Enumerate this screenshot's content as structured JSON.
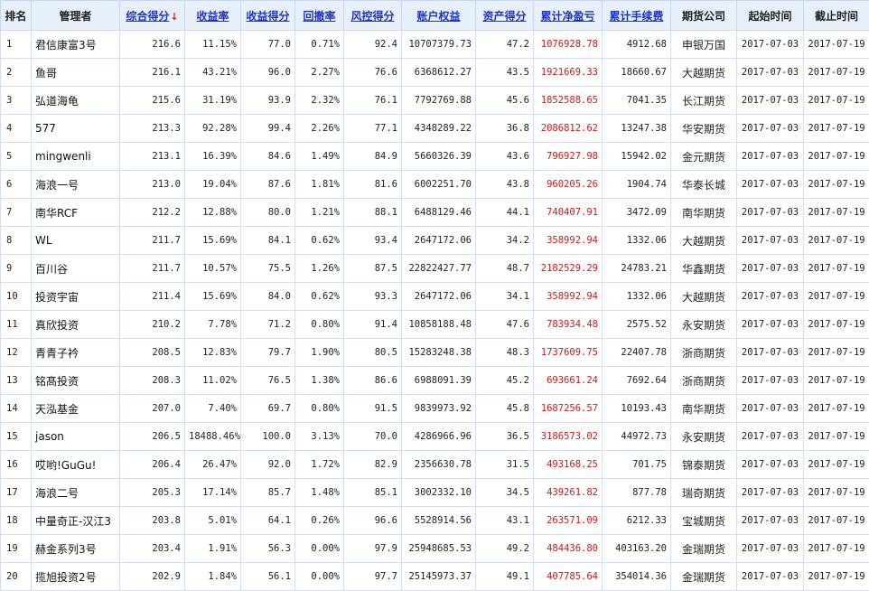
{
  "headers": {
    "rank": "排名",
    "manager": "管理者",
    "total_score": "综合得分",
    "sort_arrow": "↓",
    "yield": "收益率",
    "yield_score": "收益得分",
    "drawdown": "回撤率",
    "risk_score": "风控得分",
    "equity": "账户权益",
    "asset_score": "资产得分",
    "net_pnl": "累计净盈亏",
    "fees": "累计手续费",
    "broker": "期货公司",
    "start": "起始时间",
    "end": "截止时间"
  },
  "colors": {
    "header_bg": "#e8f0fb",
    "link": "#1a35c9",
    "pnl_red": "#d01818",
    "sort_arrow": "#e02020"
  },
  "rows": [
    {
      "rank": "1",
      "manager": "君信康富3号",
      "total_score": "216.6",
      "yield": "11.15%",
      "yield_score": "77.0",
      "drawdown": "0.71%",
      "risk_score": "92.4",
      "equity": "10707379.73",
      "asset_score": "47.2",
      "net_pnl": "1076928.78",
      "fees": "4912.68",
      "broker": "申银万国",
      "start": "2017-07-03",
      "end": "2017-07-19"
    },
    {
      "rank": "2",
      "manager": "鱼哥",
      "total_score": "216.1",
      "yield": "43.21%",
      "yield_score": "96.0",
      "drawdown": "2.27%",
      "risk_score": "76.6",
      "equity": "6368612.27",
      "asset_score": "43.5",
      "net_pnl": "1921669.33",
      "fees": "18660.67",
      "broker": "大越期货",
      "start": "2017-07-03",
      "end": "2017-07-19"
    },
    {
      "rank": "3",
      "manager": "弘道海龟",
      "total_score": "215.6",
      "yield": "31.19%",
      "yield_score": "93.9",
      "drawdown": "2.32%",
      "risk_score": "76.1",
      "equity": "7792769.88",
      "asset_score": "45.6",
      "net_pnl": "1852588.65",
      "fees": "7041.35",
      "broker": "长江期货",
      "start": "2017-07-03",
      "end": "2017-07-19"
    },
    {
      "rank": "4",
      "manager": "577",
      "total_score": "213.3",
      "yield": "92.28%",
      "yield_score": "99.4",
      "drawdown": "2.26%",
      "risk_score": "77.1",
      "equity": "4348289.22",
      "asset_score": "36.8",
      "net_pnl": "2086812.62",
      "fees": "13247.38",
      "broker": "华安期货",
      "start": "2017-07-03",
      "end": "2017-07-19"
    },
    {
      "rank": "5",
      "manager": "mingwenli",
      "total_score": "213.1",
      "yield": "16.39%",
      "yield_score": "84.6",
      "drawdown": "1.49%",
      "risk_score": "84.9",
      "equity": "5660326.39",
      "asset_score": "43.6",
      "net_pnl": "796927.98",
      "fees": "15942.02",
      "broker": "金元期货",
      "start": "2017-07-03",
      "end": "2017-07-19"
    },
    {
      "rank": "6",
      "manager": "海浪一号",
      "total_score": "213.0",
      "yield": "19.04%",
      "yield_score": "87.6",
      "drawdown": "1.81%",
      "risk_score": "81.6",
      "equity": "6002251.70",
      "asset_score": "43.8",
      "net_pnl": "960205.26",
      "fees": "1904.74",
      "broker": "华泰长城",
      "start": "2017-07-03",
      "end": "2017-07-19"
    },
    {
      "rank": "7",
      "manager": "南华RCF",
      "total_score": "212.2",
      "yield": "12.88%",
      "yield_score": "80.0",
      "drawdown": "1.21%",
      "risk_score": "88.1",
      "equity": "6488129.46",
      "asset_score": "44.1",
      "net_pnl": "740407.91",
      "fees": "3472.09",
      "broker": "南华期货",
      "start": "2017-07-03",
      "end": "2017-07-19"
    },
    {
      "rank": "8",
      "manager": "WL",
      "total_score": "211.7",
      "yield": "15.69%",
      "yield_score": "84.1",
      "drawdown": "0.62%",
      "risk_score": "93.4",
      "equity": "2647172.06",
      "asset_score": "34.2",
      "net_pnl": "358992.94",
      "fees": "1332.06",
      "broker": "大越期货",
      "start": "2017-07-03",
      "end": "2017-07-19"
    },
    {
      "rank": "9",
      "manager": "百川谷",
      "total_score": "211.7",
      "yield": "10.57%",
      "yield_score": "75.5",
      "drawdown": "1.26%",
      "risk_score": "87.5",
      "equity": "22822427.77",
      "asset_score": "48.7",
      "net_pnl": "2182529.29",
      "fees": "24783.21",
      "broker": "华鑫期货",
      "start": "2017-07-03",
      "end": "2017-07-19"
    },
    {
      "rank": "10",
      "manager": "投资宇宙",
      "total_score": "211.4",
      "yield": "15.69%",
      "yield_score": "84.0",
      "drawdown": "0.62%",
      "risk_score": "93.3",
      "equity": "2647172.06",
      "asset_score": "34.1",
      "net_pnl": "358992.94",
      "fees": "1332.06",
      "broker": "大越期货",
      "start": "2017-07-03",
      "end": "2017-07-19"
    },
    {
      "rank": "11",
      "manager": "真欣投资",
      "total_score": "210.2",
      "yield": "7.78%",
      "yield_score": "71.2",
      "drawdown": "0.80%",
      "risk_score": "91.4",
      "equity": "10858188.48",
      "asset_score": "47.6",
      "net_pnl": "783934.48",
      "fees": "2575.52",
      "broker": "永安期货",
      "start": "2017-07-03",
      "end": "2017-07-19"
    },
    {
      "rank": "12",
      "manager": "青青子衿",
      "total_score": "208.5",
      "yield": "12.83%",
      "yield_score": "79.7",
      "drawdown": "1.90%",
      "risk_score": "80.5",
      "equity": "15283248.38",
      "asset_score": "48.3",
      "net_pnl": "1737609.75",
      "fees": "22407.78",
      "broker": "浙商期货",
      "start": "2017-07-03",
      "end": "2017-07-19"
    },
    {
      "rank": "13",
      "manager": "铭髙投资",
      "total_score": "208.3",
      "yield": "11.02%",
      "yield_score": "76.5",
      "drawdown": "1.38%",
      "risk_score": "86.6",
      "equity": "6988091.39",
      "asset_score": "45.2",
      "net_pnl": "693661.24",
      "fees": "7692.64",
      "broker": "浙商期货",
      "start": "2017-07-03",
      "end": "2017-07-19"
    },
    {
      "rank": "14",
      "manager": "天泓基金",
      "total_score": "207.0",
      "yield": "7.40%",
      "yield_score": "69.7",
      "drawdown": "0.80%",
      "risk_score": "91.5",
      "equity": "9839973.92",
      "asset_score": "45.8",
      "net_pnl": "1687256.57",
      "fees": "10193.43",
      "broker": "南华期货",
      "start": "2017-07-03",
      "end": "2017-07-19"
    },
    {
      "rank": "15",
      "manager": "jason",
      "total_score": "206.5",
      "yield": "18488.46%",
      "yield_score": "100.0",
      "drawdown": "3.13%",
      "risk_score": "70.0",
      "equity": "4286966.96",
      "asset_score": "36.5",
      "net_pnl": "3186573.02",
      "fees": "44972.73",
      "broker": "永安期货",
      "start": "2017-07-03",
      "end": "2017-07-19"
    },
    {
      "rank": "16",
      "manager": "哎哟!GuGu!",
      "total_score": "206.4",
      "yield": "26.47%",
      "yield_score": "92.0",
      "drawdown": "1.72%",
      "risk_score": "82.9",
      "equity": "2356630.78",
      "asset_score": "31.5",
      "net_pnl": "493168.25",
      "fees": "701.75",
      "broker": "锦泰期货",
      "start": "2017-07-03",
      "end": "2017-07-19"
    },
    {
      "rank": "17",
      "manager": "海浪二号",
      "total_score": "205.3",
      "yield": "17.14%",
      "yield_score": "85.7",
      "drawdown": "1.48%",
      "risk_score": "85.1",
      "equity": "3002332.10",
      "asset_score": "34.5",
      "net_pnl": "439261.82",
      "fees": "877.78",
      "broker": "瑞奇期货",
      "start": "2017-07-03",
      "end": "2017-07-19"
    },
    {
      "rank": "18",
      "manager": "中量奇正-汉江3",
      "total_score": "203.8",
      "yield": "5.01%",
      "yield_score": "64.1",
      "drawdown": "0.26%",
      "risk_score": "96.6",
      "equity": "5528914.56",
      "asset_score": "43.1",
      "net_pnl": "263571.09",
      "fees": "6212.33",
      "broker": "宝城期货",
      "start": "2017-07-03",
      "end": "2017-07-19"
    },
    {
      "rank": "19",
      "manager": "赫金系列3号",
      "total_score": "203.4",
      "yield": "1.91%",
      "yield_score": "56.3",
      "drawdown": "0.00%",
      "risk_score": "97.9",
      "equity": "25948685.53",
      "asset_score": "49.2",
      "net_pnl": "484436.80",
      "fees": "403163.20",
      "broker": "金瑞期货",
      "start": "2017-07-03",
      "end": "2017-07-19"
    },
    {
      "rank": "20",
      "manager": "揽旭投资2号",
      "total_score": "202.9",
      "yield": "1.84%",
      "yield_score": "56.1",
      "drawdown": "0.00%",
      "risk_score": "97.7",
      "equity": "25145973.37",
      "asset_score": "49.1",
      "net_pnl": "407785.64",
      "fees": "354014.36",
      "broker": "金瑞期货",
      "start": "2017-07-03",
      "end": "2017-07-19"
    }
  ]
}
